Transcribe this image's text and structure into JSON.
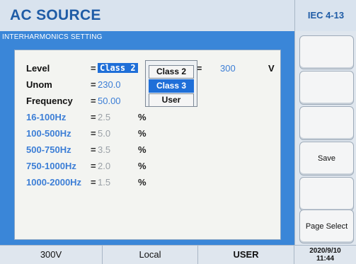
{
  "header": {
    "title": "AC SOURCE",
    "standard": "IEC 4-13"
  },
  "panel": {
    "title": "INTERHARMONICS SETTING"
  },
  "settings": {
    "level": {
      "label": "Level",
      "eq": "=",
      "value": "Class 2"
    },
    "unom": {
      "label": "Unom",
      "eq": "=",
      "value": "230.0"
    },
    "frequency": {
      "label": "Frequency",
      "eq": "=",
      "value": "50.00"
    },
    "voltage": {
      "label": "ge =",
      "value": "300",
      "unit": "V"
    },
    "bands": [
      {
        "label": "16-100Hz",
        "eq": "=",
        "value": "2.5",
        "unit": "%"
      },
      {
        "label": "100-500Hz",
        "eq": "=",
        "value": "5.0",
        "unit": "%"
      },
      {
        "label": "500-750Hz",
        "eq": "=",
        "value": "3.5",
        "unit": "%"
      },
      {
        "label": "750-1000Hz",
        "eq": "=",
        "value": "2.0",
        "unit": "%"
      },
      {
        "label": "1000-2000Hz",
        "eq": "=",
        "value": "1.5",
        "unit": "%"
      }
    ]
  },
  "dropdown": {
    "options": [
      "Class 2",
      "Class 3",
      "User"
    ],
    "selected": "Class 3"
  },
  "side_buttons": [
    "",
    "",
    "",
    "Save",
    "",
    "Page Select"
  ],
  "status": {
    "voltage": "300V",
    "mode": "Local",
    "user": "USER",
    "date": "2020/9/10",
    "time": "11:44"
  },
  "colors": {
    "accent": "#3a86d8",
    "selection": "#1f6fd8",
    "title": "#1f5ca6"
  }
}
